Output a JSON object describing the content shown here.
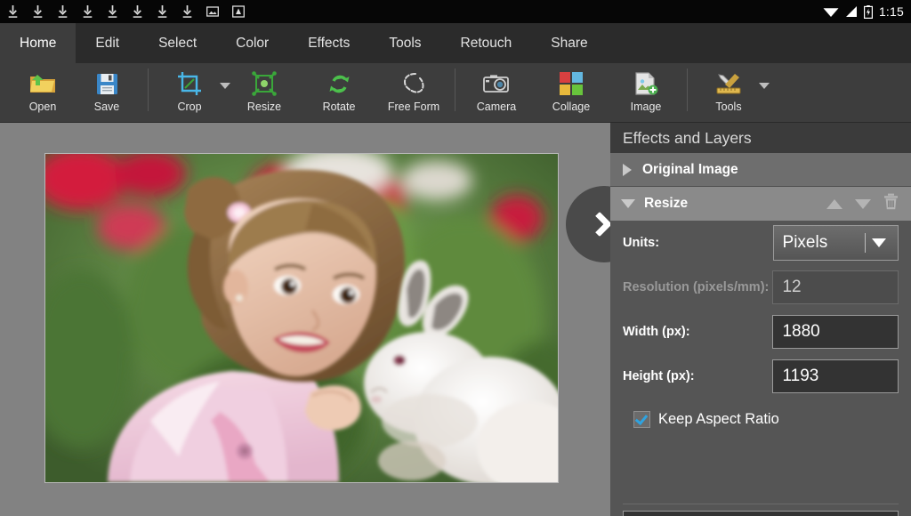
{
  "statusbar": {
    "download_icons": [
      "download-icon",
      "download-icon",
      "download-icon",
      "download-icon",
      "download-icon",
      "download-icon",
      "download-icon",
      "download-icon"
    ],
    "screenshot_icon": "image-icon",
    "app_icon": "app-icon",
    "wifi_icon": "wifi-icon",
    "signal_icon": "signal-icon",
    "battery_icon": "battery-icon",
    "time": "1:15"
  },
  "tabs": [
    {
      "label": "Home",
      "active": true
    },
    {
      "label": "Edit",
      "active": false
    },
    {
      "label": "Select",
      "active": false
    },
    {
      "label": "Color",
      "active": false
    },
    {
      "label": "Effects",
      "active": false
    },
    {
      "label": "Tools",
      "active": false
    },
    {
      "label": "Retouch",
      "active": false
    },
    {
      "label": "Share",
      "active": false
    }
  ],
  "toolbar": {
    "items": [
      {
        "label": "Open",
        "icon": "open-folder-icon",
        "caret": false
      },
      {
        "label": "Save",
        "icon": "save-floppy-icon",
        "caret": false
      },
      {
        "label": "Crop",
        "icon": "crop-icon",
        "caret": true
      },
      {
        "label": "Resize",
        "icon": "resize-icon",
        "caret": false
      },
      {
        "label": "Rotate",
        "icon": "rotate-icon",
        "caret": false
      },
      {
        "label": "Free Form",
        "icon": "free-form-icon",
        "caret": false
      },
      {
        "label": "Camera",
        "icon": "camera-icon",
        "caret": false
      },
      {
        "label": "Collage",
        "icon": "collage-icon",
        "caret": false
      },
      {
        "label": "Image",
        "icon": "image-add-icon",
        "caret": false
      },
      {
        "label": "Tools",
        "icon": "tools-icon",
        "caret": true
      }
    ]
  },
  "canvas": {
    "expand_button_icon": "chevron-right-icon",
    "photo_alt": "girl-with-white-rabbit-photo",
    "background_color": "#828282"
  },
  "panel": {
    "title": "Effects and Layers",
    "layers": [
      {
        "name": "Original Image",
        "expanded": false,
        "toggle_icon": "triangle-right-icon"
      },
      {
        "name": "Resize",
        "expanded": true,
        "toggle_icon": "triangle-down-icon"
      }
    ],
    "layer_actions": {
      "move_up_icon": "arrow-up-icon",
      "move_down_icon": "arrow-down-icon",
      "delete_icon": "trash-icon"
    },
    "resize_form": {
      "units_label": "Units:",
      "units_value": "Pixels",
      "units_dropdown_icon": "chevron-down-icon",
      "resolution_label": "Resolution (pixels/mm):",
      "resolution_value": "12",
      "width_label": "Width (px):",
      "width_value": "1880",
      "height_label": "Height (px):",
      "height_value": "1193",
      "keep_aspect_label": "Keep Aspect Ratio",
      "keep_aspect_checked": true,
      "checkbox_icon": "checkmark-icon"
    },
    "accent_color": "#2ea3e0"
  }
}
